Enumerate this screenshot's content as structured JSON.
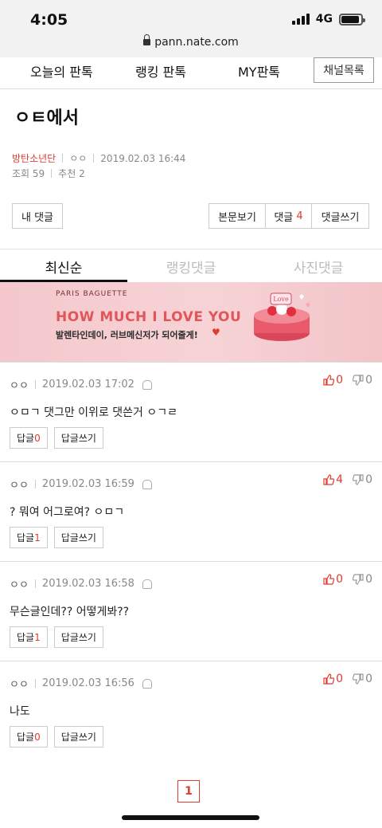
{
  "status": {
    "time": "4:05",
    "network": "4G",
    "battery_level": 0.9
  },
  "browser": {
    "url": "pann.nate.com"
  },
  "nav": {
    "tabs": [
      "오늘의 판톡",
      "랭킹 판톡",
      "MY판톡"
    ],
    "channel_list": "채널목록"
  },
  "post": {
    "title": "ㅇㅌ에서",
    "author": "방탄소년단",
    "nickname": "ㅇㅇ",
    "date": "2019.02.03 16:44",
    "views": "조회 59",
    "recommends": "추천 2"
  },
  "actions": {
    "my_comments": "내 댓글",
    "view_post": "본문보기",
    "comments_label": "댓글",
    "comments_count": "4",
    "write_comment": "댓글쓰기"
  },
  "sort_tabs": {
    "latest": "최신순",
    "ranking": "랭킹댓글",
    "photo": "사진댓글"
  },
  "banner": {
    "brand": "PARIS BAGUETTE",
    "headline": "HOW MUCH I LOVE YOU",
    "subline": "발렌타인데이, 러브메신저가 되어줄게!",
    "heart": "♥",
    "cake_text": "Love"
  },
  "comments": [
    {
      "nickname": "ㅇㅇ",
      "date": "2019.02.03 17:02",
      "text": "ㅇㅁㄱ 댓그만 이위로 댓쓴거 ㅇㄱㄹ",
      "likes": "0",
      "dislikes": "0",
      "reply_label": "답글",
      "reply_count": "0",
      "write_reply": "답글쓰기"
    },
    {
      "nickname": "ㅇㅇ",
      "date": "2019.02.03 16:59",
      "text": "? 뭐여 어그로여? ㅇㅁㄱ",
      "likes": "4",
      "dislikes": "0",
      "reply_label": "답글",
      "reply_count": "1",
      "write_reply": "답글쓰기"
    },
    {
      "nickname": "ㅇㅇ",
      "date": "2019.02.03 16:58",
      "text": "무슨글인데?? 어떻게봐??",
      "likes": "0",
      "dislikes": "0",
      "reply_label": "답글",
      "reply_count": "1",
      "write_reply": "답글쓰기"
    },
    {
      "nickname": "ㅇㅇ",
      "date": "2019.02.03 16:56",
      "text": "나도",
      "likes": "0",
      "dislikes": "0",
      "reply_label": "답글",
      "reply_count": "0",
      "write_reply": "답글쓰기"
    }
  ],
  "pagination": {
    "current_page": "1"
  },
  "colors": {
    "accent_red": "#e03a30",
    "banner_pink": "#f4c8cc"
  }
}
